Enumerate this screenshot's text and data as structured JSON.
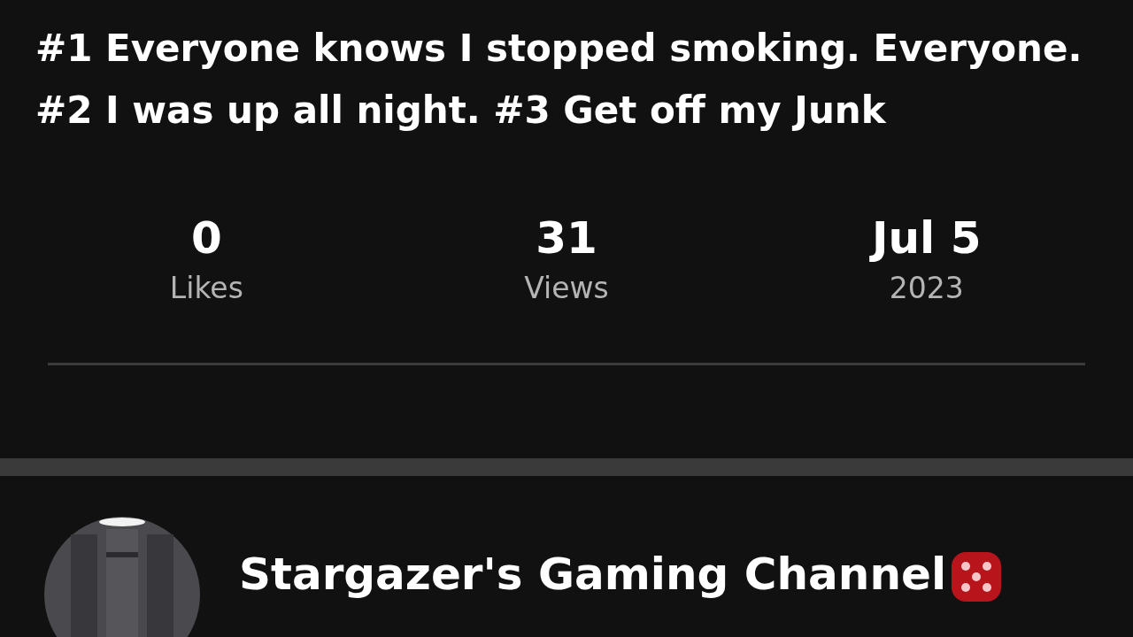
{
  "post": {
    "text": "#1 Everyone knows I stopped smoking. Everyone. #2 I was up all night. #3 Get off my Junk"
  },
  "stats": [
    {
      "value": "0",
      "label": "Likes"
    },
    {
      "value": "31",
      "label": "Views"
    },
    {
      "value": "Jul 5",
      "label": "2023"
    }
  ],
  "channel": {
    "name": "Stargazer's Gaming Channel"
  }
}
